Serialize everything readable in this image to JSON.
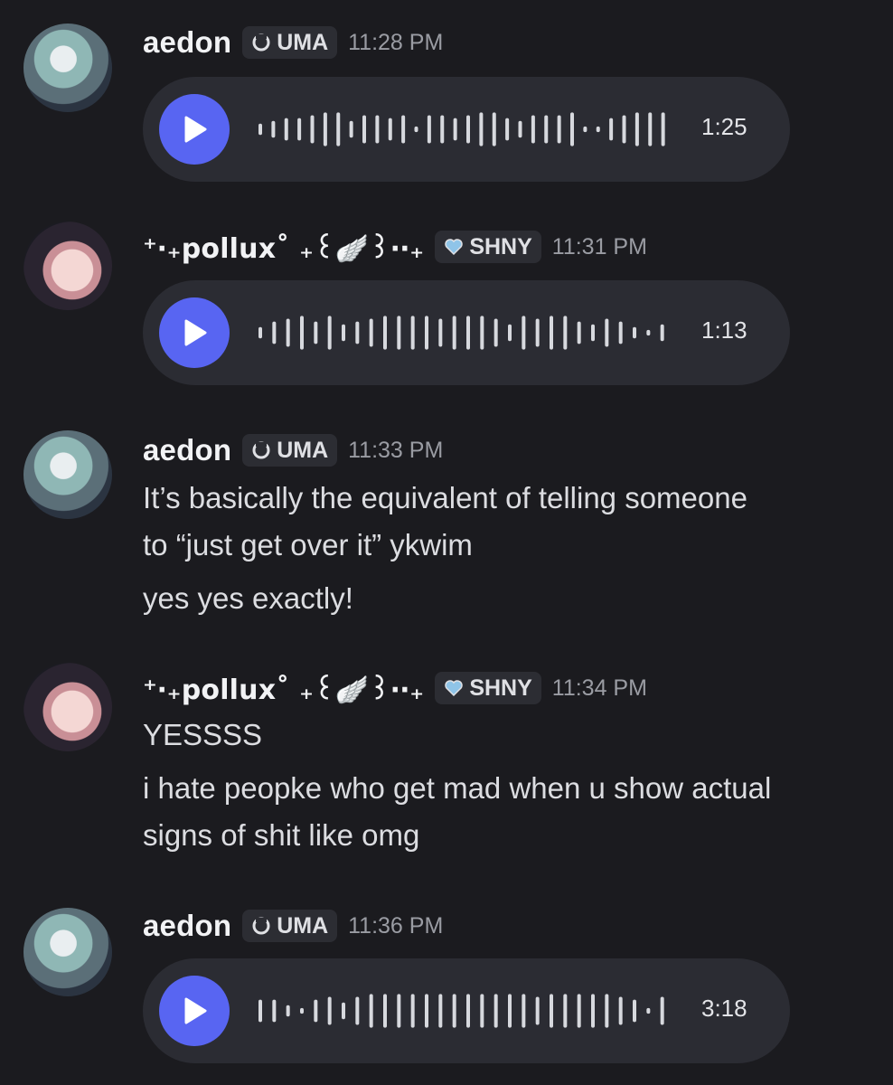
{
  "messages": [
    {
      "author": "aedon",
      "tag": "UMA",
      "time": "11:28 PM",
      "voice_duration": "1:25"
    },
    {
      "author": "⁺‧₊pollux˚ ₊꒰🪽꒱‧‧₊",
      "tag": "SHNY",
      "time": "11:31 PM",
      "voice_duration": "1:13"
    },
    {
      "author": "aedon",
      "tag": "UMA",
      "time": "11:33 PM",
      "lines": [
        "It’s basically the equivalent of telling someone",
        "to “just get over it” ykwim",
        "yes yes exactly!"
      ]
    },
    {
      "author": "⁺‧₊pollux˚ ₊꒰🪽꒱‧‧₊",
      "tag": "SHNY",
      "time": "11:34 PM",
      "lines": [
        "YESSSS",
        "i hate peopke who get mad when u show actual",
        "signs of shit like omg"
      ]
    },
    {
      "author": "aedon",
      "tag": "UMA",
      "time": "11:36 PM",
      "voice_duration": "3:18"
    }
  ],
  "icons": {
    "play": "play-icon",
    "tag_uma": "ring-icon",
    "tag_shny": "heart-icon"
  },
  "colors": {
    "background": "#1b1b1f",
    "play_button": "#5865f2",
    "bubble": "#2b2c33"
  }
}
